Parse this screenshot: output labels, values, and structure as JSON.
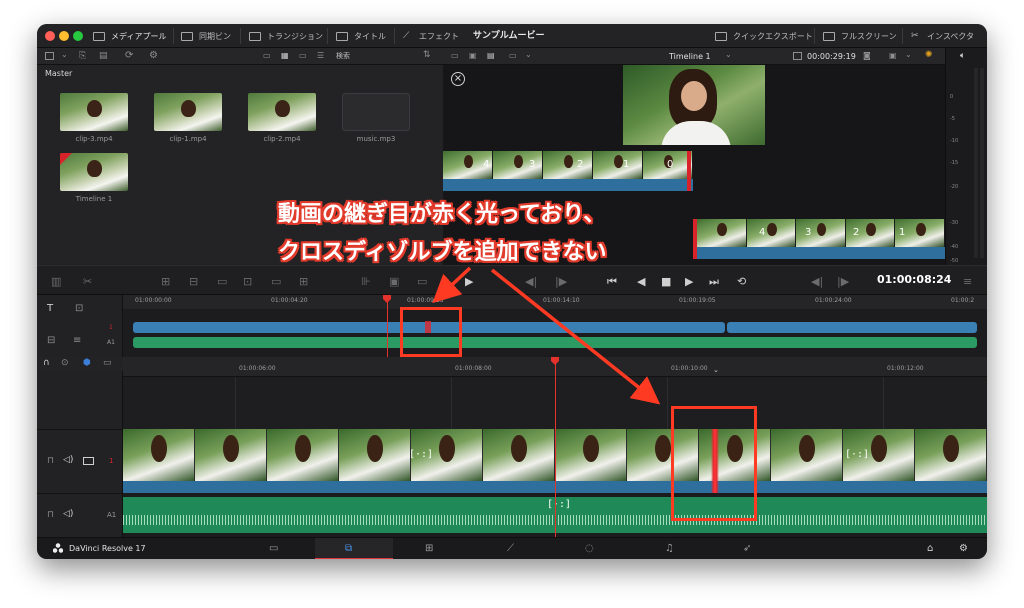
{
  "toolbar": {
    "media_pool": "メディアプール",
    "sync_bin": "同期ビン",
    "transitions": "トランジション",
    "titles": "タイトル",
    "effects": "エフェクト",
    "project_title": "サンプルムービー",
    "quick_export": "クイックエクスポート",
    "fullscreen": "フルスクリーン",
    "inspector": "インスペクタ"
  },
  "media_pool": {
    "search_label": "検索",
    "bin": "Master",
    "clips": [
      {
        "name": "clip-3.mp4",
        "kind": "video"
      },
      {
        "name": "clip-1.mp4",
        "kind": "video"
      },
      {
        "name": "clip-2.mp4",
        "kind": "video"
      },
      {
        "name": "music.mp3",
        "kind": "audio"
      },
      {
        "name": "Timeline 1",
        "kind": "timeline"
      }
    ]
  },
  "viewer": {
    "timeline_name": "Timeline 1",
    "source_timecode": "00:00:29:19",
    "countdown_top": [
      "4",
      "3",
      "2",
      "1",
      "0"
    ],
    "countdown_bottom": [
      "4",
      "3",
      "2",
      "1"
    ]
  },
  "meter_scale": [
    "0",
    "-5",
    "-10",
    "-15",
    "-20",
    "-30",
    "-40",
    "-50"
  ],
  "transport": {
    "timecode": "01:00:08:24"
  },
  "mini_timeline": {
    "ruler": [
      "01:00:00:00",
      "01:00:04:20",
      "01:00:09:15",
      "01:00:14:10",
      "01:00:19:05",
      "01:00:24:00",
      "01:00:2"
    ],
    "track_video": "1",
    "track_audio": "A1"
  },
  "timeline": {
    "ruler": [
      "01:00:06:00",
      "01:00:08:00",
      "01:00:10:00",
      "01:00:12:00"
    ],
    "video_track_num": "1",
    "audio_track_num": "A1",
    "transition_glyph": "[·:]"
  },
  "pagebar": {
    "app_name": "DaVinci Resolve 17"
  },
  "annotation": {
    "line1": "動画の継ぎ目が赤く光っており、",
    "line2": "クロスディゾルブを追加できない",
    "accent": "#ff3a23"
  }
}
